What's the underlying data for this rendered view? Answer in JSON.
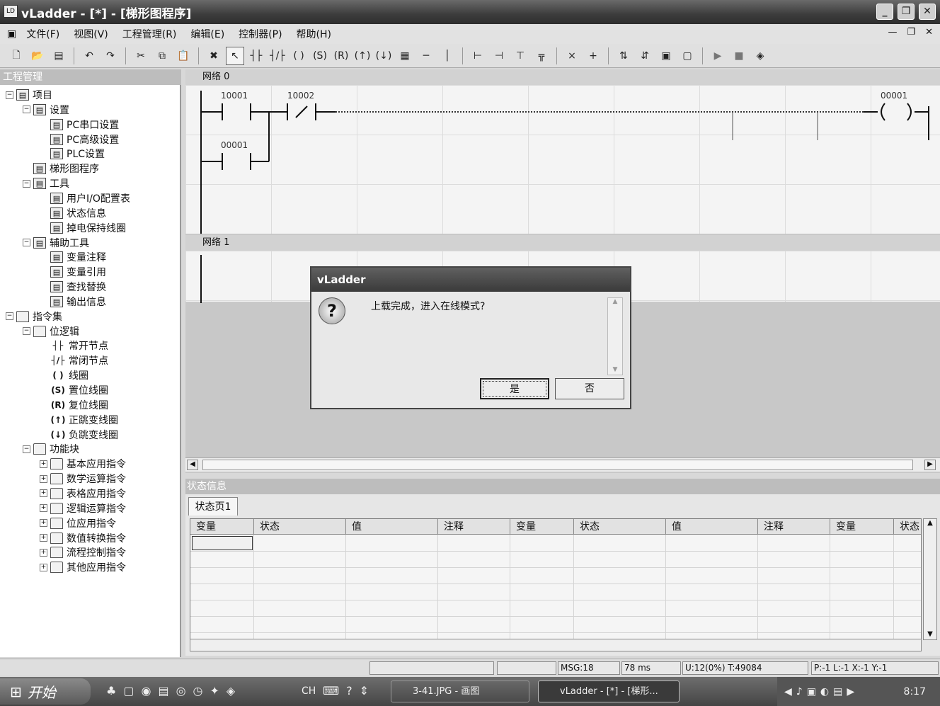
{
  "window": {
    "title": "vLadder - [*] - [梯形图程序]",
    "app_icon": "vladder-app-icon"
  },
  "menu": [
    "文件(F)",
    "视图(V)",
    "工程管理(R)",
    "编辑(E)",
    "控制器(P)",
    "帮助(H)"
  ],
  "left_pane": {
    "title": "工程管理",
    "tree": [
      {
        "label": "项目",
        "level": 0,
        "exp": "−"
      },
      {
        "label": "设置",
        "level": 1,
        "exp": "−"
      },
      {
        "label": "PC串口设置",
        "level": 2
      },
      {
        "label": "PC高级设置",
        "level": 2
      },
      {
        "label": "PLC设置",
        "level": 2
      },
      {
        "label": "梯形图程序",
        "level": 1
      },
      {
        "label": "工具",
        "level": 1,
        "exp": "−"
      },
      {
        "label": "用户I/O配置表",
        "level": 2
      },
      {
        "label": "状态信息",
        "level": 2
      },
      {
        "label": "掉电保持线圈",
        "level": 2
      },
      {
        "label": "辅助工具",
        "level": 1,
        "exp": "−"
      },
      {
        "label": "变量注释",
        "level": 2
      },
      {
        "label": "变量引用",
        "level": 2
      },
      {
        "label": "查找替换",
        "level": 2
      },
      {
        "label": "输出信息",
        "level": 2
      },
      {
        "label": "指令集",
        "level": 0,
        "exp": "−"
      },
      {
        "label": "位逻辑",
        "level": 1,
        "exp": "−"
      },
      {
        "label": "常开节点",
        "level": 2,
        "sym": "┤├"
      },
      {
        "label": "常闭节点",
        "level": 2,
        "sym": "┤/├"
      },
      {
        "label": "线圈",
        "level": 2,
        "sym": "( )"
      },
      {
        "label": "置位线圈",
        "level": 2,
        "sym": "(S)"
      },
      {
        "label": "复位线圈",
        "level": 2,
        "sym": "(R)"
      },
      {
        "label": "正跳变线圈",
        "level": 2,
        "sym": "(↑)"
      },
      {
        "label": "负跳变线圈",
        "level": 2,
        "sym": "(↓)"
      },
      {
        "label": "功能块",
        "level": 1,
        "exp": "−"
      },
      {
        "label": "基本应用指令",
        "level": 2,
        "exp": "+"
      },
      {
        "label": "数学运算指令",
        "level": 2,
        "exp": "+"
      },
      {
        "label": "表格应用指令",
        "level": 2,
        "exp": "+"
      },
      {
        "label": "逻辑运算指令",
        "level": 2,
        "exp": "+"
      },
      {
        "label": "位应用指令",
        "level": 2,
        "exp": "+"
      },
      {
        "label": "数值转换指令",
        "level": 2,
        "exp": "+"
      },
      {
        "label": "流程控制指令",
        "level": 2,
        "exp": "+"
      },
      {
        "label": "其他应用指令",
        "level": 2,
        "exp": "+"
      }
    ]
  },
  "editor": {
    "network0": "网络 0",
    "network1": "网络 1",
    "contact1": "10001",
    "contact2": "10002",
    "contact3": "00001",
    "coil": "00001"
  },
  "status_panel": {
    "title": "状态信息",
    "tab": "状态页1",
    "columns": [
      "变量",
      "状态",
      "值",
      "注释",
      "变量",
      "状态",
      "值",
      "注释",
      "变量",
      "状态"
    ]
  },
  "statusbar": {
    "msg": "MSG:18",
    "time": "78 ms",
    "usage": "U:12(0%) T:49084",
    "pos": "P:-1 L:-1 X:-1 Y:-1"
  },
  "taskbar": {
    "start": "开始",
    "lang": "CH",
    "task1": "3-41.JPG - 画图",
    "task2": "vLadder - [*] - [梯形...",
    "clock": "8:17"
  },
  "dialog": {
    "title": "vLadder",
    "message": "上载完成，进入在线模式?",
    "yes": "是",
    "no": "否"
  }
}
